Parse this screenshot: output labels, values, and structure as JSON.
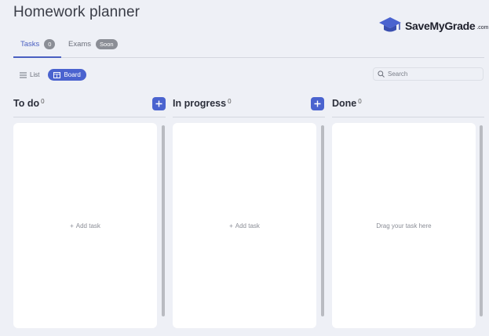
{
  "page": {
    "title": "Homework planner"
  },
  "logo": {
    "name": "SaveMyGrade",
    "domain": ".com"
  },
  "tabs": [
    {
      "label": "Tasks",
      "badge": "0"
    },
    {
      "label": "Exams",
      "badge": "Soon"
    }
  ],
  "view_toggle": {
    "list_label": "List",
    "board_label": "Board",
    "selected": "Board"
  },
  "search": {
    "placeholder": "Search",
    "value": ""
  },
  "columns": [
    {
      "title": "To do",
      "count": "0",
      "empty_text": "Add task",
      "has_add_button": true
    },
    {
      "title": "In progress",
      "count": "0",
      "empty_text": "Add task",
      "has_add_button": true
    },
    {
      "title": "Done",
      "count": "0",
      "empty_text": "Drag your task here",
      "has_add_button": false
    }
  ],
  "colors": {
    "accent": "#4a63cf",
    "tab_active": "#4a5fc1",
    "background": "#eef0f6",
    "panel": "#ffffff",
    "badge": "#8b8e96"
  },
  "icons": [
    "graduation-cap-icon",
    "list-icon",
    "board-icon",
    "search-icon",
    "plus-icon"
  ]
}
